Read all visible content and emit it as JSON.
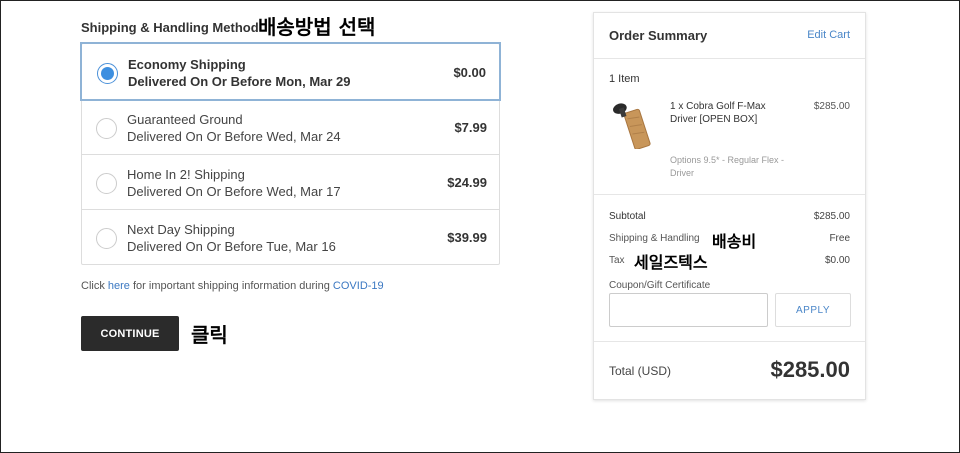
{
  "shipping": {
    "title": "Shipping & Handling Method",
    "options": [
      {
        "name": "Economy Shipping",
        "date": "Delivered On Or Before Mon, Mar 29",
        "price": "$0.00",
        "selected": true
      },
      {
        "name": "Guaranteed Ground",
        "date": "Delivered On Or Before Wed, Mar 24",
        "price": "$7.99",
        "selected": false
      },
      {
        "name": "Home In 2! Shipping",
        "date": "Delivered On Or Before Wed, Mar 17",
        "price": "$24.99",
        "selected": false
      },
      {
        "name": "Next Day Shipping",
        "date": "Delivered On Or Before Tue, Mar 16",
        "price": "$39.99",
        "selected": false
      }
    ],
    "note_prefix": "Click ",
    "note_link1": "here",
    "note_middle": " for important shipping information during ",
    "note_link2": "COVID-19",
    "continue_label": "CONTINUE"
  },
  "annotations": {
    "select_method": "배송방법 선택",
    "click": "클릭",
    "shipping_fee": "배송비",
    "sales_tax": "세일즈텍스"
  },
  "summary": {
    "title": "Order Summary",
    "edit_cart": "Edit Cart",
    "item_count": "1 Item",
    "item_name": "1 x Cobra Golf F-Max Driver [OPEN BOX]",
    "item_price": "$285.00",
    "item_options": "Options 9.5* - Regular Flex - Driver",
    "subtotal_label": "Subtotal",
    "subtotal_value": "$285.00",
    "shipping_label": "Shipping & Handling",
    "shipping_value": "Free",
    "tax_label": "Tax",
    "tax_value": "$0.00",
    "coupon_label": "Coupon/Gift Certificate",
    "coupon_value": "",
    "apply_label": "APPLY",
    "total_label": "Total (USD)",
    "total_value": "$285.00"
  },
  "colors": {
    "accent_link": "#4a86c8",
    "radio_selected": "#3d8fe0",
    "selected_border": "#8fb3d6",
    "button_dark": "#2b2b2b"
  }
}
